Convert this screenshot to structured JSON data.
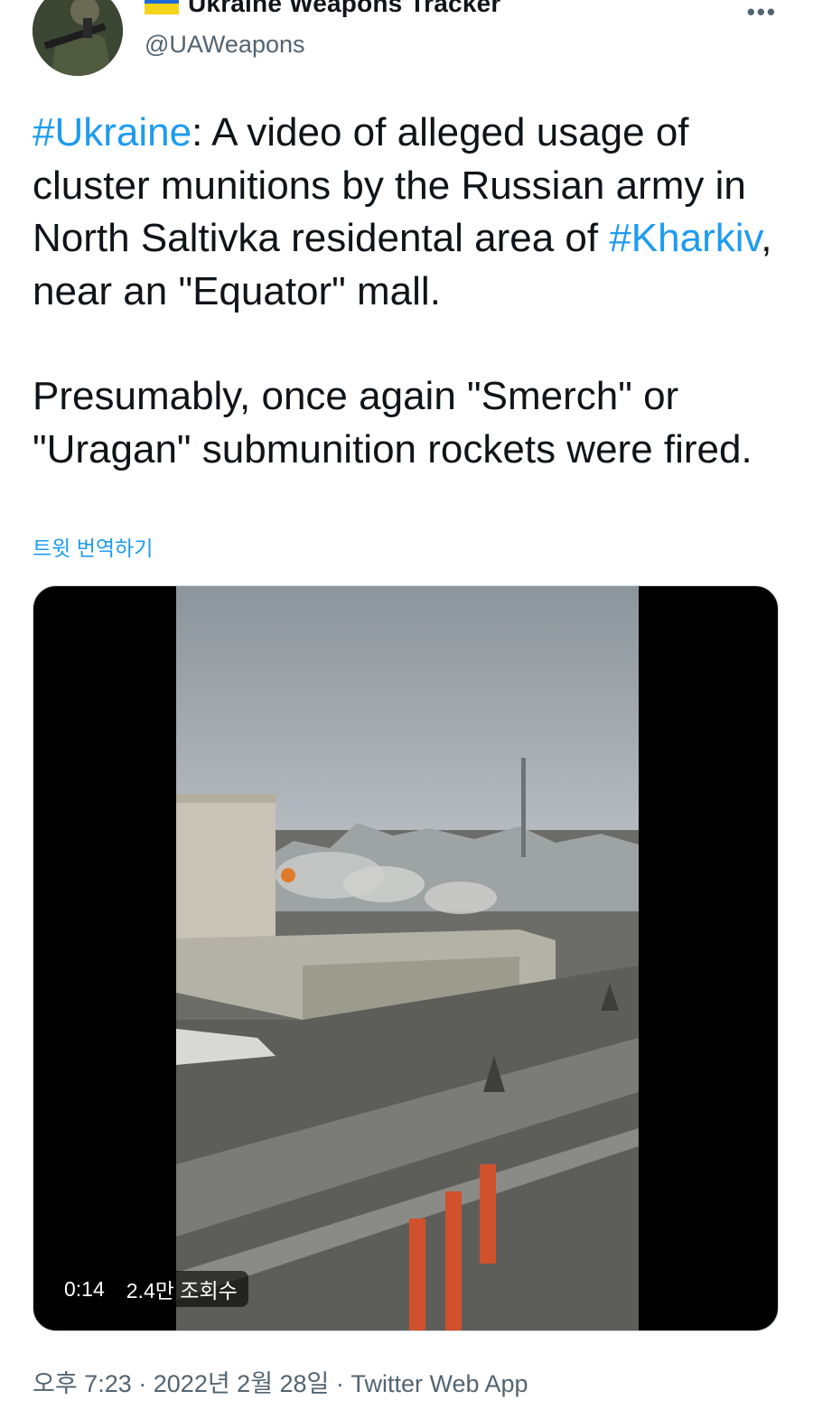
{
  "author": {
    "display_name": "Ukraine Weapons Tracker",
    "handle": "@UAWeapons",
    "flag_colors": [
      "#1f6bd6",
      "#f4d318"
    ],
    "avatar_icon": "soldier-avatar-icon",
    "more_icon": "more-options-icon",
    "more_glyph": "•••"
  },
  "tweet": {
    "para1": {
      "hashtag1": "#Ukraine",
      "text1": ": A video of alleged usage of cluster munitions by the Russian army in North Saltivka residental area of ",
      "hashtag2": "#Kharkiv",
      "text2": ", near an \"Equator\" mall."
    },
    "para2": "Presumably, once again \"Smerch\" or \"Uragan\" submunition rockets were fired.",
    "translate_label": "트윗 번역하기"
  },
  "media": {
    "type": "video",
    "duration": "0:14",
    "views": "2.4만 조회수"
  },
  "meta": {
    "time": "오후 7:23",
    "separator": "·",
    "date": "2022년 2월 28일",
    "source": "Twitter Web App"
  },
  "colors": {
    "link": "#1d9bf0",
    "text": "#0f1419",
    "secondary": "#536471"
  }
}
